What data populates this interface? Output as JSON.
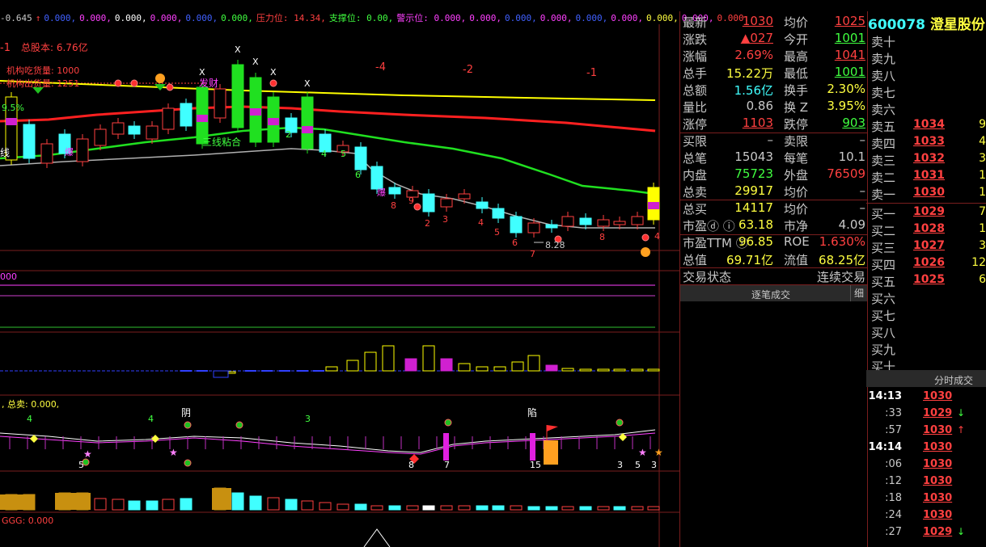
{
  "topbar": {
    "items": [
      {
        "text": "-0.645",
        "color": "#c8c8c8"
      },
      {
        "text": "↑",
        "color": "#ff4040"
      },
      {
        "text": "0.000,",
        "color": "#4060ff"
      },
      {
        "text": "0.000,",
        "color": "#ff40ff"
      },
      {
        "text": "0.000,",
        "color": "#ffffff"
      },
      {
        "text": "0.000,",
        "color": "#ff40ff"
      },
      {
        "text": "0.000,",
        "color": "#4060ff"
      },
      {
        "text": "0.000,",
        "color": "#40ff40"
      },
      {
        "text": "压力位: 14.34,",
        "color": "#ff4040"
      },
      {
        "text": "支撑位: 0.00,",
        "color": "#40ff40"
      },
      {
        "text": "警示位: 0.000,",
        "color": "#ff40ff"
      },
      {
        "text": "0.000,",
        "color": "#ff40ff"
      },
      {
        "text": "0.000,",
        "color": "#4060ff"
      },
      {
        "text": "0.000,",
        "color": "#ff40ff"
      },
      {
        "text": "0.000,",
        "color": "#4060ff"
      },
      {
        "text": "0.000,",
        "color": "#ff40ff"
      },
      {
        "text": "0.000,",
        "color": "#ffff40"
      },
      {
        "text": "0.000,",
        "color": "#ff40ff"
      },
      {
        "text": "0.000.",
        "color": "#ff4040"
      }
    ]
  },
  "annotations": {
    "total_shares": "总股本: 6.76亿",
    "inst_absorb": "机构吃货量: 1000",
    "inst_ship": "机构出货量: 1251",
    "pct_label": "9.5%",
    "line_text": "线",
    "bonded_text": "三线粘合",
    "fa_cai": "发财",
    "minus4": "-4",
    "minus2": "-2",
    "minus1": "-1",
    "minus1_left": "-1",
    "low_price": "8.28",
    "bao1": "爆",
    "bao2": "爆",
    "sub1_val": "000",
    "sub3_label": ", 总卖: 0.000,",
    "yin_label": "阴",
    "xian_label": "陷",
    "bottom_label": "GGG: 0.000"
  },
  "quote": {
    "rows": [
      {
        "l1": "最新",
        "v1": "1030",
        "c1": "#ff4040",
        "u1": true,
        "l2": "均价",
        "v2": "1025",
        "c2": "#ff4040",
        "u2": true
      },
      {
        "l1": "涨跌",
        "v1": "▲027",
        "c1": "#ff4040",
        "u1": true,
        "l2": "今开",
        "v2": "1001",
        "c2": "#40ff40",
        "u2": true
      },
      {
        "l1": "涨幅",
        "v1": "2.69%",
        "c1": "#ff4040",
        "u1": false,
        "l2": "最高",
        "v2": "1041",
        "c2": "#ff4040",
        "u2": true
      },
      {
        "l1": "总手",
        "v1": "15.22万",
        "c1": "#ffff40",
        "u1": false,
        "l2": "最低",
        "v2": "1001",
        "c2": "#40ff40",
        "u2": true
      },
      {
        "l1": "总额",
        "v1": "1.56亿",
        "c1": "#40ffff",
        "u1": false,
        "l2": "换手",
        "v2": "2.30%",
        "c2": "#ffff40",
        "u2": false
      },
      {
        "l1": "量比",
        "v1": "0.86",
        "c1": "#c8c8c8",
        "u1": false,
        "l2": "换 Z",
        "v2": "3.95%",
        "c2": "#ffff40",
        "u2": false
      },
      {
        "l1": "涨停",
        "v1": "1103",
        "c1": "#ff4040",
        "u1": true,
        "l2": "跌停",
        "v2": "903",
        "c2": "#40ff40",
        "u2": true
      },
      {
        "l1": "买限",
        "v1": "–",
        "c1": "#c8c8c8",
        "u1": false,
        "l2": "卖限",
        "v2": "–",
        "c2": "#c8c8c8",
        "u2": false
      },
      {
        "l1": "总笔",
        "v1": "15043",
        "c1": "#c8c8c8",
        "u1": false,
        "l2": "每笔",
        "v2": "10.1",
        "c2": "#c8c8c8",
        "u2": false
      },
      {
        "l1": "内盘",
        "v1": "75723",
        "c1": "#40ff40",
        "u1": false,
        "l2": "外盘",
        "v2": "76509",
        "c2": "#ff4040",
        "u2": false
      },
      {
        "l1": "总卖",
        "v1": "29917",
        "c1": "#ffff40",
        "u1": false,
        "l2": "均价",
        "v2": "–",
        "c2": "#c8c8c8",
        "u2": false
      },
      {
        "l1": "总买",
        "v1": "14117",
        "c1": "#ffff40",
        "u1": false,
        "l2": "均价",
        "v2": "–",
        "c2": "#c8c8c8",
        "u2": false
      },
      {
        "l1": "市盈ⓓ ⓘ",
        "v1": "63.18",
        "c1": "#ffff40",
        "u1": false,
        "l2": "市净",
        "v2": "4.09",
        "c2": "#c8c8c8",
        "u2": false
      },
      {
        "l1": "市盈TTM ⓘ",
        "v1": "96.85",
        "c1": "#ffff40",
        "u1": false,
        "l2": "ROE",
        "v2": "1.630%",
        "c2": "#ff4040",
        "u2": false
      },
      {
        "l1": "总值",
        "v1": "69.71亿",
        "c1": "#ffff40",
        "u1": false,
        "l2": "流值",
        "v2": "68.25亿",
        "c2": "#ffff40",
        "u2": false
      },
      {
        "l1": "交易状态",
        "v1": "",
        "c1": "#c8c8c8",
        "u1": false,
        "l2": "",
        "v2": "连续交易",
        "c2": "#c8c8c8",
        "u2": false
      }
    ],
    "trade_tab": "逐笔成交",
    "detail_tab": "细"
  },
  "book": {
    "code": "600078",
    "name": "澄星股份",
    "asks": [
      {
        "label": "卖十",
        "price": "",
        "vol": ""
      },
      {
        "label": "卖九",
        "price": "",
        "vol": ""
      },
      {
        "label": "卖八",
        "price": "",
        "vol": ""
      },
      {
        "label": "卖七",
        "price": "",
        "vol": ""
      },
      {
        "label": "卖六",
        "price": "",
        "vol": ""
      },
      {
        "label": "卖五",
        "price": "1034",
        "vol": "9"
      },
      {
        "label": "卖四",
        "price": "1033",
        "vol": "4"
      },
      {
        "label": "卖三",
        "price": "1032",
        "vol": "3"
      },
      {
        "label": "卖二",
        "price": "1031",
        "vol": "1"
      },
      {
        "label": "卖一",
        "price": "1030",
        "vol": "1"
      }
    ],
    "bids": [
      {
        "label": "买一",
        "price": "1029",
        "vol": "7"
      },
      {
        "label": "买二",
        "price": "1028",
        "vol": "1"
      },
      {
        "label": "买三",
        "price": "1027",
        "vol": "3"
      },
      {
        "label": "买四",
        "price": "1026",
        "vol": "12"
      },
      {
        "label": "买五",
        "price": "1025",
        "vol": "6"
      },
      {
        "label": "买六",
        "price": "",
        "vol": ""
      },
      {
        "label": "买七",
        "price": "",
        "vol": ""
      },
      {
        "label": "买八",
        "price": "",
        "vol": ""
      },
      {
        "label": "买九",
        "price": "",
        "vol": ""
      },
      {
        "label": "买十",
        "price": "",
        "vol": ""
      }
    ],
    "ticks_tab": "分时成交",
    "ticks": [
      {
        "time": "14:13",
        "price": "1030",
        "arrow": "",
        "bold": true
      },
      {
        "time": ":33",
        "price": "1029",
        "arrow": "↓",
        "bold": false
      },
      {
        "time": ":57",
        "price": "1030",
        "arrow": "↑",
        "bold": false
      },
      {
        "time": "14:14",
        "price": "1030",
        "arrow": "",
        "bold": true
      },
      {
        "time": ":06",
        "price": "1030",
        "arrow": "",
        "bold": false
      },
      {
        "time": ":12",
        "price": "1030",
        "arrow": "",
        "bold": false
      },
      {
        "time": ":18",
        "price": "1030",
        "arrow": "",
        "bold": false
      },
      {
        "time": ":24",
        "price": "1030",
        "arrow": "",
        "bold": false
      },
      {
        "time": ":27",
        "price": "1029",
        "arrow": "↓",
        "bold": false
      }
    ]
  },
  "colors": {
    "up": "#ff4040",
    "down": "#40ffff",
    "ma_yellow": "#ffff00",
    "ma_red": "#ff2020",
    "ma_green": "#20e020",
    "ma_gray": "#b0b0b0",
    "panel_border": "#7a1e1e"
  }
}
